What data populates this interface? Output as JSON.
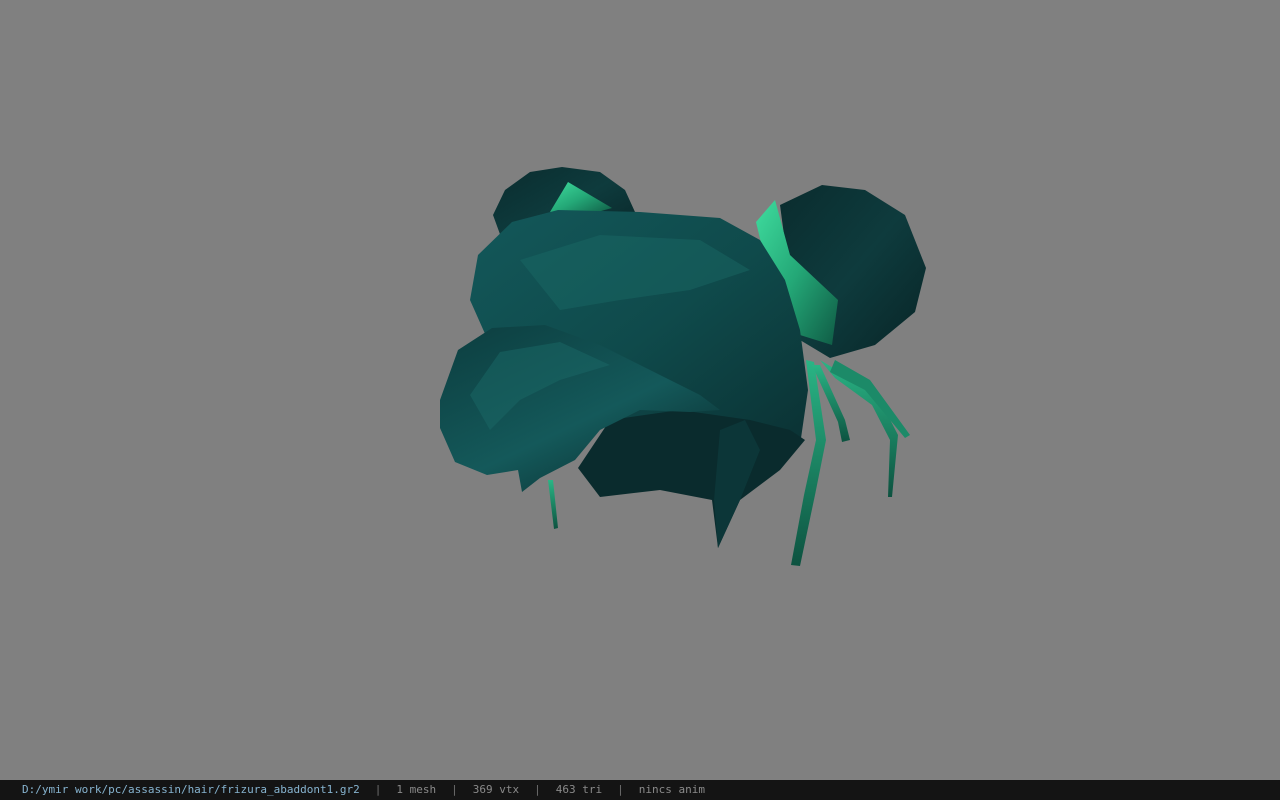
{
  "viewport": {
    "background": "#808080",
    "model_colors": {
      "dark": "#0b2f30",
      "mid": "#0e4a4a",
      "light": "#1a6a62",
      "accent": "#2dbb8a"
    }
  },
  "statusbar": {
    "path": "D:/ymir work/pc/assassin/hair/frizura_abaddont1.gr2",
    "separator": "|",
    "mesh": "1 mesh",
    "vertices": "369 vtx",
    "triangles": "463 tri",
    "anim": "nincs anim"
  }
}
